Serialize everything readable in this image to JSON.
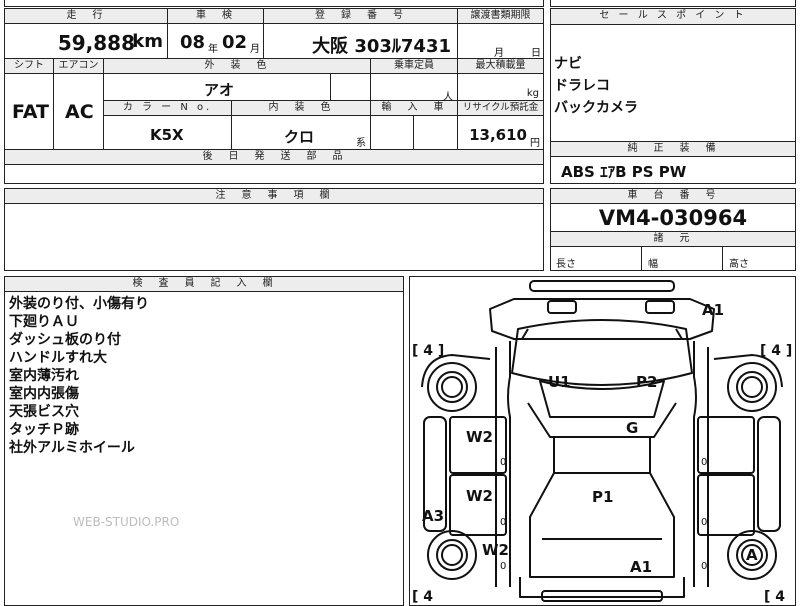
{
  "vehicle": {
    "mileage_header": "走　行",
    "mileage": "59,888",
    "mileage_unit": "km",
    "inspection_header": "車　検",
    "inspection_year": "08",
    "inspection_year_unit": "年",
    "inspection_month": "02",
    "inspection_month_unit": "月",
    "registration_header": "登　録　番　号",
    "registration_number": "大阪 303ﾙ7431",
    "transfer_header": "譲渡書類期限",
    "transfer_month_unit": "月",
    "transfer_day_unit": "日",
    "shift_header": "シフト",
    "shift": "FAT",
    "ac_header": "エアコン",
    "ac": "AC",
    "exterior_color_header": "外　装　色",
    "exterior_color": "アオ",
    "capacity_header": "乗車定員",
    "capacity_unit": "人",
    "max_load_header": "最大積載量",
    "max_load_unit": "kg",
    "color_no_header": "カ ラ ー N o.",
    "color_no": "K5X",
    "interior_color_header": "内　装　色",
    "interior_color": "クロ",
    "interior_suffix": "系",
    "import_header": "輸　入　車",
    "recycle_header": "リサイクル預託金",
    "recycle_amount": "13,610",
    "recycle_unit": "円",
    "later_parts_header": "後　日　発　送　部　品"
  },
  "sales_points": {
    "header": "セ ー ル ス ポ イ ン ト",
    "items": [
      "ナビ",
      "ドラレコ",
      "バックカメラ"
    ]
  },
  "standard_equipment": {
    "header": "純　正　装　備",
    "value": "ABS ｴｱB PS PW"
  },
  "cautions": {
    "header": "注　意　事　項　欄"
  },
  "chassis": {
    "header": "車　台　番　号",
    "value": "VM4-030964",
    "dims_header": "諸　元",
    "length_label": "長さ",
    "width_label": "幅",
    "height_label": "高さ"
  },
  "inspector": {
    "header": "検　査　員　記　入　欄",
    "notes": [
      "外装のり付、小傷有り",
      "下廻りＡＵ",
      "ダッシュ板のり付",
      "ハンドルすれ大",
      "室内薄汚れ",
      "室内内張傷",
      "天張ビス穴",
      "タッチＰ跡",
      "社外アルミホイール"
    ],
    "watermark": "WEB-STUDIO.PRO"
  },
  "diagram": {
    "marks": {
      "a1_top": "A1",
      "u1": "U1",
      "p2": "P2",
      "g": "G",
      "w2_a": "W2",
      "w2_b": "W2",
      "w2_c": "W2",
      "p1": "P1",
      "a3": "A3",
      "a1_bottom": "A1",
      "a_wheel": "A"
    },
    "tire_tl": "[ 4 ]",
    "tire_tr": "[ 4 ]",
    "tire_bl": "[ 4",
    "tire_br": "[ 4",
    "zero_a": "0",
    "zero_b": "0",
    "zero_c": "0",
    "zero_d": "0",
    "zero_e": "0",
    "zero_f": "0"
  }
}
